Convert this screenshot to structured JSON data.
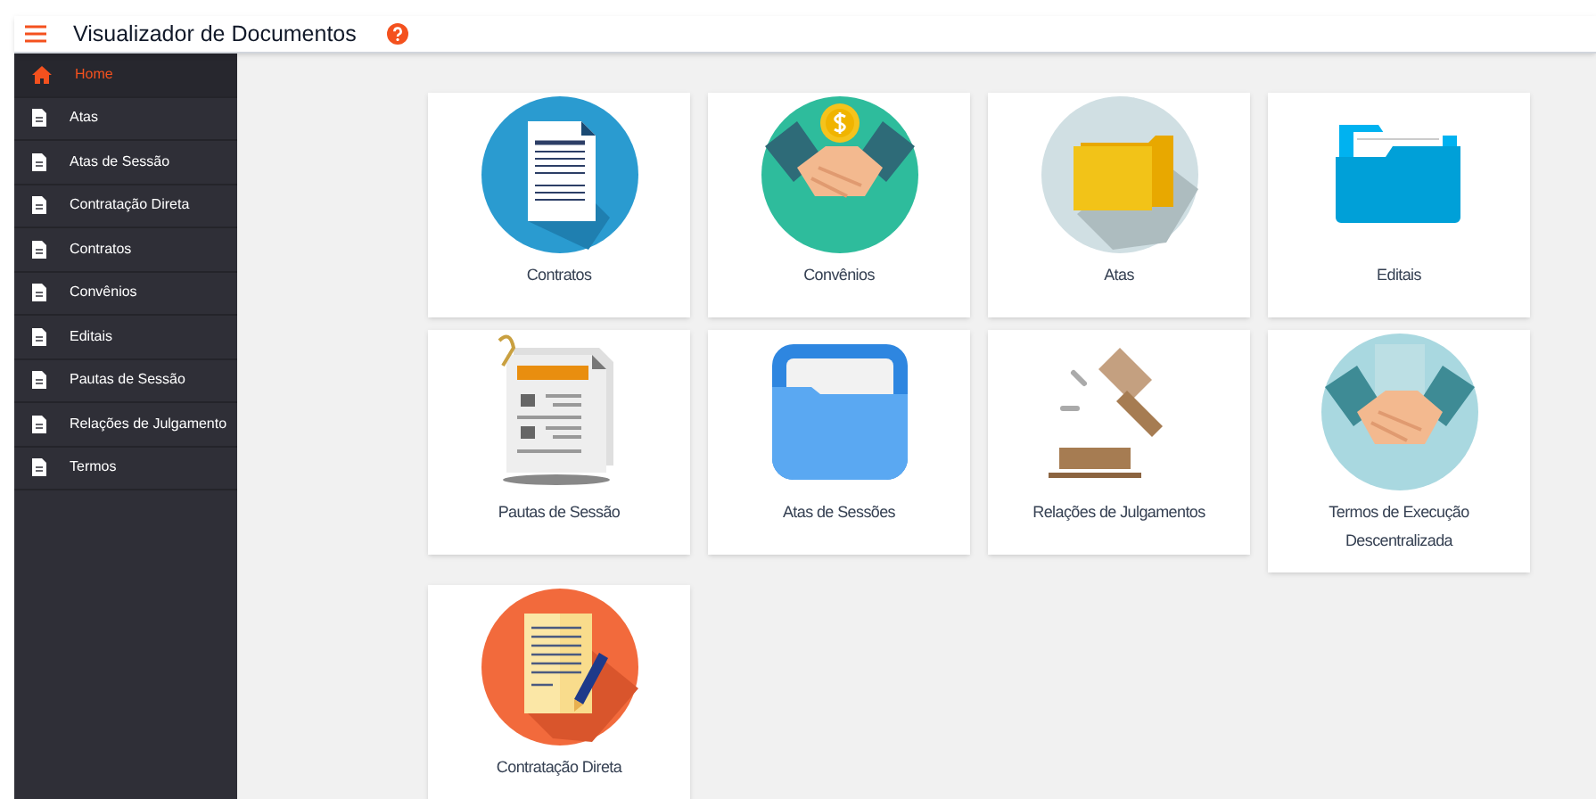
{
  "app_bar": {
    "title": "Visualizador de Documentos"
  },
  "sidebar": {
    "items": [
      {
        "label": "Home",
        "kind": "home",
        "selected": true
      },
      {
        "label": "Atas",
        "kind": "doc",
        "selected": false
      },
      {
        "label": "Atas de Sessão",
        "kind": "doc",
        "selected": false
      },
      {
        "label": "Contratação Direta",
        "kind": "doc",
        "selected": false
      },
      {
        "label": "Contratos",
        "kind": "doc",
        "selected": false
      },
      {
        "label": "Convênios",
        "kind": "doc",
        "selected": false
      },
      {
        "label": "Editais",
        "kind": "doc",
        "selected": false
      },
      {
        "label": "Pautas de Sessão",
        "kind": "doc",
        "selected": false
      },
      {
        "label": "Relações de Julgamento",
        "kind": "doc",
        "selected": false
      },
      {
        "label": "Termos",
        "kind": "doc",
        "selected": false
      }
    ]
  },
  "cards": [
    {
      "label": "Contratos",
      "kind": "contract"
    },
    {
      "label": "Convênios",
      "kind": "deal"
    },
    {
      "label": "Atas",
      "kind": "folder"
    },
    {
      "label": "Editais",
      "kind": "openfolder"
    },
    {
      "label": "Pautas de Sessão",
      "kind": "agenda"
    },
    {
      "label": "Atas de Sessões",
      "kind": "appfolder"
    },
    {
      "label": "Relações de Julgamentos",
      "kind": "gavel"
    },
    {
      "label": "Termos de Execução Descentralizada",
      "kind": "handshake"
    },
    {
      "label": "Contratação Direta",
      "kind": "signing"
    }
  ]
}
